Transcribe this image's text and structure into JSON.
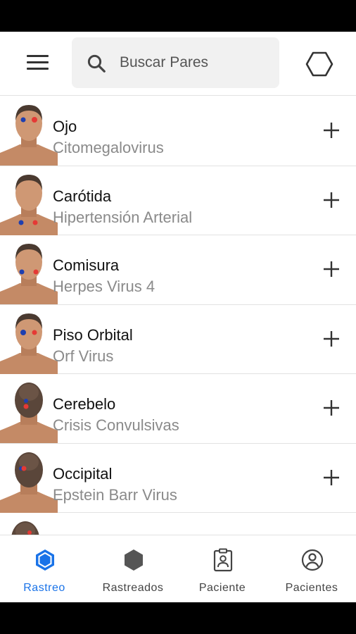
{
  "header": {
    "menu_icon": "menu-icon",
    "search_icon": "search-icon",
    "search_placeholder": "Buscar Pares",
    "action_icon": "hexagon-outline-icon"
  },
  "items": [
    {
      "title": "Ojo",
      "subtitle": "Citomegalovirus",
      "view": "front",
      "add_icon": "plus-icon"
    },
    {
      "title": "Carótida",
      "subtitle": "Hipertensión Arterial",
      "view": "front",
      "add_icon": "plus-icon"
    },
    {
      "title": "Comisura",
      "subtitle": "Herpes Virus 4",
      "view": "front",
      "add_icon": "plus-icon"
    },
    {
      "title": "Piso Orbital",
      "subtitle": "Orf Virus",
      "view": "front",
      "add_icon": "plus-icon"
    },
    {
      "title": "Cerebelo",
      "subtitle": "Crisis Convulsivas",
      "view": "back",
      "add_icon": "plus-icon"
    },
    {
      "title": "Occipital",
      "subtitle": "Epstein Barr Virus",
      "view": "back",
      "add_icon": "plus-icon"
    }
  ],
  "nav": [
    {
      "label": "Rastreo",
      "icon": "hexagon-filled-icon",
      "active": true
    },
    {
      "label": "Rastreados",
      "icon": "hexagon-filled-icon",
      "active": false
    },
    {
      "label": "Paciente",
      "icon": "clipboard-user-icon",
      "active": false
    },
    {
      "label": "Pacientes",
      "icon": "account-circle-icon",
      "active": false
    }
  ],
  "colors": {
    "accent": "#1a73e8",
    "point_red": "#e53935",
    "point_blue": "#1e3fb0",
    "skin": "#c9906c",
    "hair": "#4a3a30"
  }
}
